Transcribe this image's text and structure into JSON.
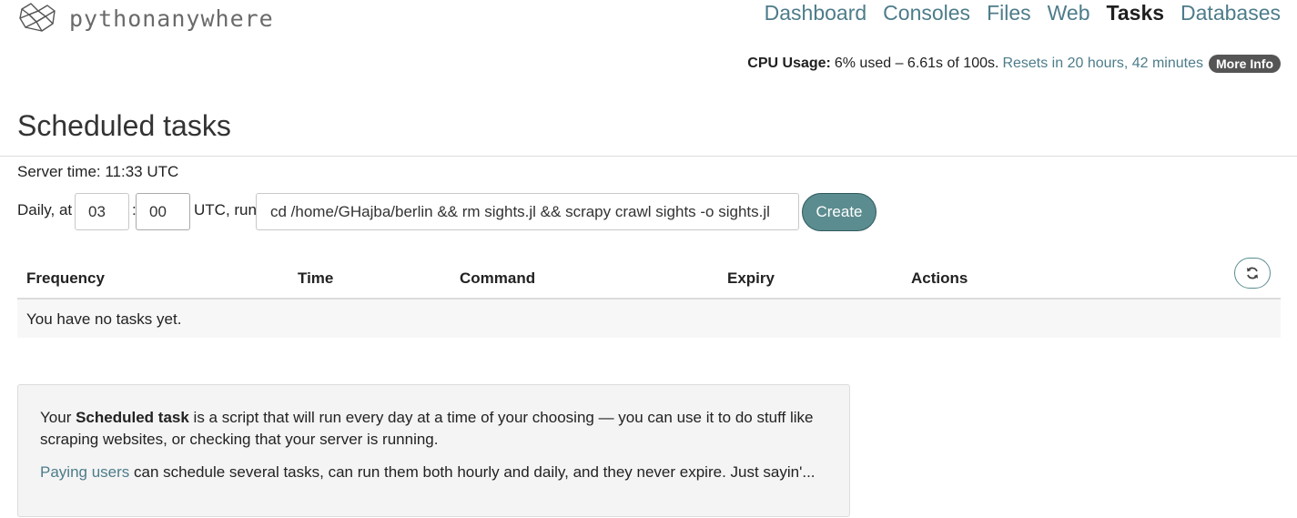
{
  "brand": {
    "name": "pythonanywhere"
  },
  "nav": {
    "items": [
      {
        "label": "Dashboard",
        "active": false
      },
      {
        "label": "Consoles",
        "active": false
      },
      {
        "label": "Files",
        "active": false
      },
      {
        "label": "Web",
        "active": false
      },
      {
        "label": "Tasks",
        "active": true
      },
      {
        "label": "Databases",
        "active": false
      }
    ]
  },
  "cpu": {
    "label": "CPU Usage:",
    "value": "6% used – 6.61s of 100s.",
    "reset": "Resets in 20 hours, 42 minutes",
    "more_info": "More Info"
  },
  "page": {
    "title": "Scheduled tasks",
    "server_time": "Server time: 11:33 UTC"
  },
  "form": {
    "daily_label": "Daily, at",
    "hour": "03",
    "separator": ":",
    "minute": "00",
    "utc_label": "UTC, run",
    "command": "cd /home/GHajba/berlin && rm sights.jl && scrapy crawl sights -o sights.jl",
    "create_label": "Create"
  },
  "table": {
    "headers": [
      "Frequency",
      "Time",
      "Command",
      "Expiry",
      "Actions"
    ],
    "empty_message": "You have no tasks yet."
  },
  "info": {
    "p1_prefix": "Your",
    "p1_bold": "Scheduled task",
    "p1_rest": "is a script that will run every day at a time of your choosing — you can use it to do stuff like scraping websites, or checking that your server is running.",
    "p2_link": "Paying users",
    "p2_rest": "can schedule several tasks, can run them both hourly and daily, and they never expire. Just sayin'..."
  },
  "colors": {
    "accent": "#4d7c8a",
    "button": "#5b8c8f",
    "badge": "#555555"
  },
  "icons": {
    "logo": "pythonanywhere-logo-icon",
    "refresh": "refresh-icon"
  }
}
